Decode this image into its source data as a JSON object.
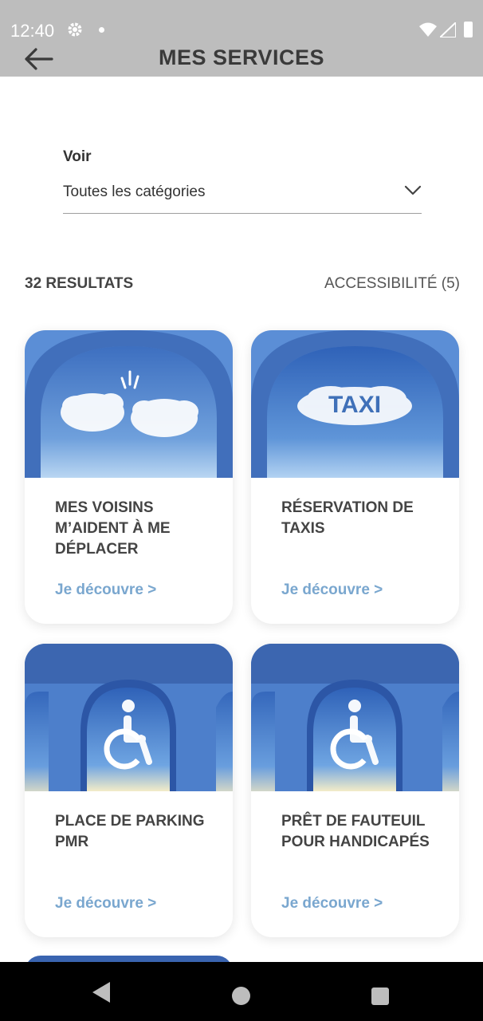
{
  "status_bar": {
    "time": "12:40"
  },
  "header": {
    "title": "MES SERVICES"
  },
  "filter": {
    "label": "Voir",
    "selected": "Toutes les catégories"
  },
  "results": {
    "count_label": "32 RESULTATS",
    "active_filter": "ACCESSIBILITÉ (5)"
  },
  "cards": [
    {
      "title": "MES VOISINS M’AIDENT À ME DÉPLACER",
      "link": "Je découvre >",
      "image": "cloud-friends"
    },
    {
      "title": "RÉSERVATION DE TAXIS",
      "link": "Je découvre >",
      "image": "taxi-cloud"
    },
    {
      "title": "PLACE DE PARKING PMR",
      "link": "Je découvre >",
      "image": "wheelchair-cloud"
    },
    {
      "title": "PRÊT DE FAUTEUIL POUR HANDICAPÉS",
      "link": "Je découvre >",
      "image": "wheelchair-cloud"
    }
  ],
  "taxi_sign_text": "TAXI",
  "colors": {
    "accent_link": "#7aa7cf",
    "status_bar": "#bdbdbd",
    "sky_blue": "#3f73c4"
  }
}
